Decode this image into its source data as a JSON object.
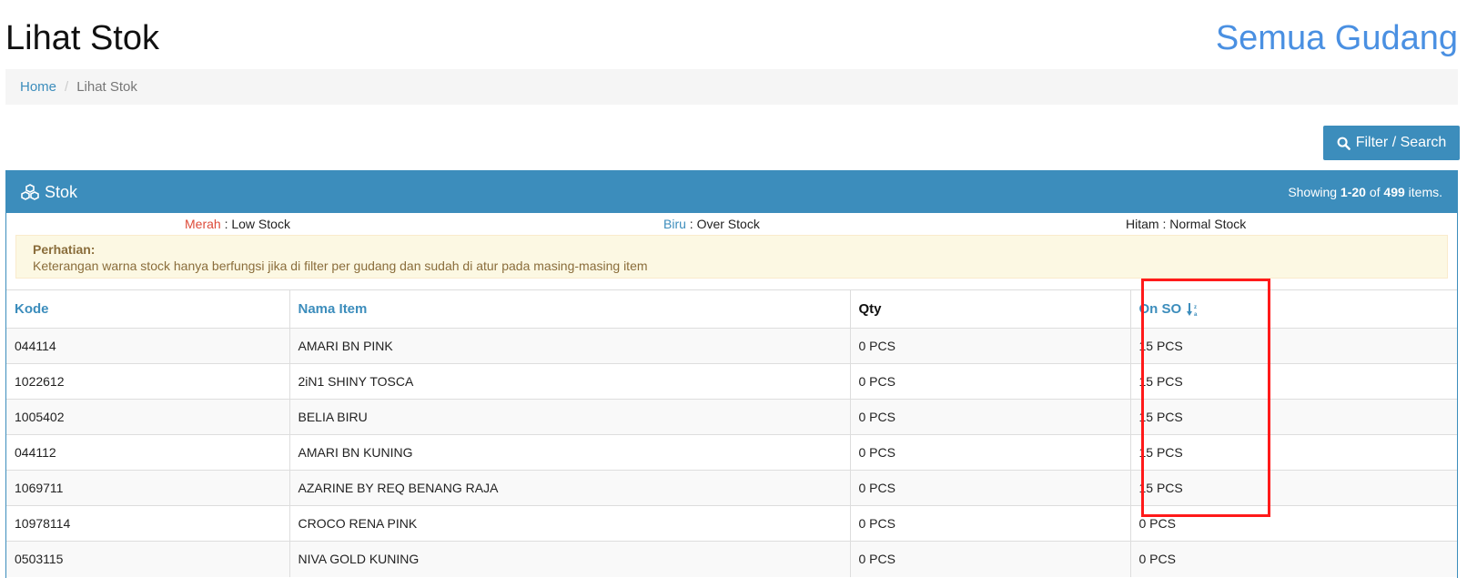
{
  "page": {
    "title": "Lihat Stok",
    "warehouse_link": "Semua Gudang"
  },
  "breadcrumb": {
    "home": "Home",
    "separator": "/",
    "current": "Lihat Stok"
  },
  "toolbar": {
    "filter_label": "Filter / Search",
    "filter_icon": "search-icon"
  },
  "panel": {
    "title": "Stok",
    "title_icon": "cubes-icon",
    "summary_prefix": "Showing",
    "summary_range": "1-20",
    "summary_of": "of",
    "summary_total": "499",
    "summary_suffix": "items."
  },
  "legend": {
    "low_color_name": "Merah",
    "low_text": ": Low Stock",
    "over_color_name": "Biru",
    "over_text": ": Over Stock",
    "normal_text": "Hitam : Normal Stock"
  },
  "alert": {
    "title": "Perhatian:",
    "message": "Keterangan warna stock hanya berfungsi jika di filter per gudang dan sudah di atur pada masing-masing item"
  },
  "table": {
    "columns": {
      "kode": "Kode",
      "nama": "Nama Item",
      "qty": "Qty",
      "on_so": "On SO"
    },
    "sort_icon": "sort-numeric-asc-icon",
    "rows": [
      {
        "kode": "044114",
        "nama": "AMARI BN PINK",
        "qty": "0 PCS",
        "on_so": "15 PCS"
      },
      {
        "kode": "1022612",
        "nama": "2iN1 SHINY TOSCA",
        "qty": "0 PCS",
        "on_so": "15 PCS"
      },
      {
        "kode": "1005402",
        "nama": "BELIA BIRU",
        "qty": "0 PCS",
        "on_so": "15 PCS"
      },
      {
        "kode": "044112",
        "nama": "AMARI BN KUNING",
        "qty": "0 PCS",
        "on_so": "15 PCS"
      },
      {
        "kode": "1069711",
        "nama": "AZARINE BY REQ BENANG RAJA",
        "qty": "0 PCS",
        "on_so": "15 PCS"
      },
      {
        "kode": "10978114",
        "nama": "CROCO RENA PINK",
        "qty": "0 PCS",
        "on_so": "0 PCS"
      },
      {
        "kode": "0503115",
        "nama": "NIVA GOLD KUNING",
        "qty": "0 PCS",
        "on_so": "0 PCS"
      }
    ]
  },
  "colors": {
    "primary": "#3c8dbc",
    "link_blue": "#4a90e2",
    "low_stock_red": "#dd4b39",
    "highlight": "#ff1a1a",
    "alert_bg": "#fcf8e3"
  }
}
